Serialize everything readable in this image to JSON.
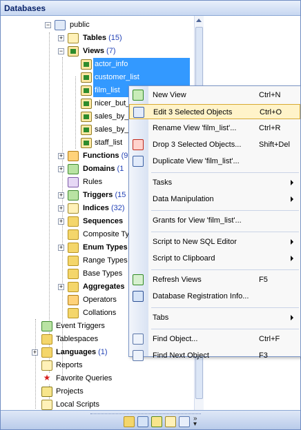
{
  "panel": {
    "title": "Databases"
  },
  "tree": [
    {
      "label": "public",
      "expander": "−",
      "icon": "schema-icon",
      "bold": false
    },
    {
      "label": "Tables",
      "count": "(15)",
      "expander": "+",
      "icon": "table-folder-icon",
      "bold": true
    },
    {
      "label": "Views",
      "count": "(7)",
      "expander": "−",
      "icon": "views-folder-icon",
      "bold": true
    },
    {
      "label": "actor_info",
      "icon": "view-icon",
      "selected": true
    },
    {
      "label": "customer_list",
      "icon": "view-icon",
      "selected": true
    },
    {
      "label": "film_list",
      "icon": "view-icon",
      "selected": true
    },
    {
      "label": "nicer_but_",
      "icon": "view-icon"
    },
    {
      "label": "sales_by_",
      "icon": "view-icon"
    },
    {
      "label": "sales_by_",
      "icon": "view-icon"
    },
    {
      "label": "staff_list",
      "icon": "view-icon"
    },
    {
      "label": "Functions",
      "count": "(9",
      "expander": "+",
      "icon": "functions-folder-icon",
      "bold": true
    },
    {
      "label": "Domains",
      "count": "(1",
      "expander": "+",
      "icon": "domains-folder-icon",
      "bold": true
    },
    {
      "label": "Rules",
      "icon": "rules-folder-icon"
    },
    {
      "label": "Triggers",
      "count": "(15",
      "expander": "+",
      "icon": "triggers-folder-icon",
      "bold": true
    },
    {
      "label": "Indices",
      "count": "(32)",
      "expander": "+",
      "icon": "indices-folder-icon",
      "bold": true
    },
    {
      "label": "Sequences",
      "expander": "+",
      "icon": "sequences-folder-icon",
      "bold": true
    },
    {
      "label": "Composite Ty",
      "icon": "composite-types-folder-icon"
    },
    {
      "label": "Enum Types",
      "expander": "+",
      "icon": "enum-types-folder-icon",
      "bold": true
    },
    {
      "label": "Range Types",
      "icon": "range-types-folder-icon"
    },
    {
      "label": "Base Types",
      "icon": "base-types-folder-icon"
    },
    {
      "label": "Aggregates",
      "expander": "+",
      "icon": "aggregates-folder-icon",
      "bold": true
    },
    {
      "label": "Operators",
      "icon": "operators-folder-icon"
    },
    {
      "label": "Collations",
      "icon": "collations-folder-icon"
    },
    {
      "label": "Event Triggers",
      "icon": "event-triggers-icon"
    },
    {
      "label": "Tablespaces",
      "icon": "tablespaces-icon"
    },
    {
      "label": "Languages",
      "count": "(1)",
      "expander": "+",
      "icon": "languages-icon",
      "bold": true
    },
    {
      "label": "Reports",
      "icon": "reports-icon"
    },
    {
      "label": "Favorite Queries",
      "icon": "favorite-queries-icon"
    },
    {
      "label": "Projects",
      "icon": "projects-icon"
    },
    {
      "label": "Local Scripts",
      "icon": "local-scripts-icon"
    }
  ],
  "context_menu": {
    "items": [
      {
        "label": "New View",
        "shortcut": "Ctrl+N",
        "icon": "new-view-icon"
      },
      {
        "label": "Edit 3 Selected Objects",
        "shortcut": "Ctrl+O",
        "icon": "edit-objects-icon",
        "highlighted": true
      },
      {
        "label": "Rename View 'film_list'...",
        "shortcut": "Ctrl+R"
      },
      {
        "label": "Drop 3 Selected Objects...",
        "shortcut": "Shift+Del",
        "icon": "drop-objects-icon"
      },
      {
        "label": "Duplicate View 'film_list'...",
        "icon": "duplicate-view-icon"
      },
      {
        "separator": true
      },
      {
        "label": "Tasks",
        "submenu": true
      },
      {
        "label": "Data Manipulation",
        "submenu": true
      },
      {
        "separator": true
      },
      {
        "label": "Grants for View 'film_list'..."
      },
      {
        "separator": true
      },
      {
        "label": "Script to New SQL Editor",
        "submenu": true
      },
      {
        "label": "Script to Clipboard",
        "submenu": true
      },
      {
        "separator": true
      },
      {
        "label": "Refresh Views",
        "shortcut": "F5",
        "icon": "refresh-icon"
      },
      {
        "label": "Database Registration Info...",
        "icon": "registration-info-icon"
      },
      {
        "separator": true
      },
      {
        "label": "Tabs",
        "submenu": true
      },
      {
        "separator": true
      },
      {
        "label": "Find Object...",
        "shortcut": "Ctrl+F",
        "icon": "find-icon"
      },
      {
        "label": "Find Next Object",
        "shortcut": "F3",
        "icon": "find-next-icon"
      }
    ]
  },
  "toolbar": {
    "buttons": [
      "databases-icon",
      "folder-icon",
      "filter-icon",
      "table-icon",
      "grid-icon",
      "more-icon"
    ]
  }
}
